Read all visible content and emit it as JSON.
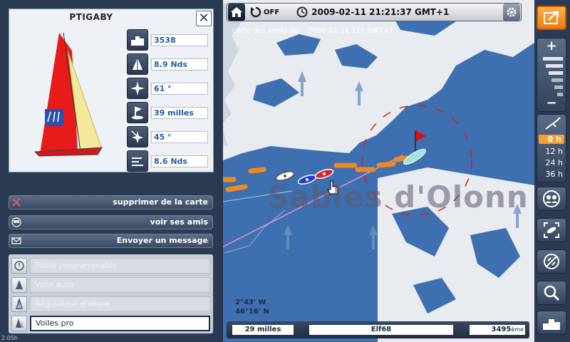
{
  "topbar": {
    "auto_refresh": "OFF",
    "datetime": "2009-02-11 21:21:37 GMT+1"
  },
  "map": {
    "wind_map_label": "carte des vents du",
    "wind_map_date": "2009-02-11 11h GMT+1",
    "place_label": "Sables d'Olonn",
    "longitude": "2°43' W",
    "latitude": "46°16' N"
  },
  "boat_card": {
    "name": "PTIGABY",
    "stats": [
      {
        "icon": "ranking-icon",
        "value": "3538"
      },
      {
        "icon": "sail-speed-icon",
        "value": "8.9 Nds"
      },
      {
        "icon": "compass-heading-icon",
        "value": "61 °"
      },
      {
        "icon": "distance-flag-icon",
        "value": "39 milles"
      },
      {
        "icon": "wind-angle-icon",
        "value": "45 °"
      },
      {
        "icon": "wind-speed-icon",
        "value": "8.6 Nds"
      }
    ]
  },
  "actions": {
    "remove_map": "supprimer de la carte",
    "see_friends": "voir ses amis",
    "send_message": "Envoyer un message"
  },
  "options": [
    {
      "label": "Pilote programmable",
      "active": false
    },
    {
      "label": "Voile auto",
      "active": false
    },
    {
      "label": "Régulateur d'allure",
      "active": false
    },
    {
      "label": "Voiles pro",
      "active": true
    }
  ],
  "version": "2.05h",
  "bottombar": {
    "distance": "29 milles",
    "player": "Elf68",
    "rank": "3495",
    "rank_suffix": "ème"
  },
  "forecast": {
    "hours": [
      "0 h",
      "12 h",
      "24 h",
      "36 h"
    ],
    "selected": "0 h"
  },
  "colors": {
    "sea": "#3e6fb0",
    "land": "#e8ebef",
    "accent_orange": "#f07a10",
    "panel": "#2a3a52"
  }
}
